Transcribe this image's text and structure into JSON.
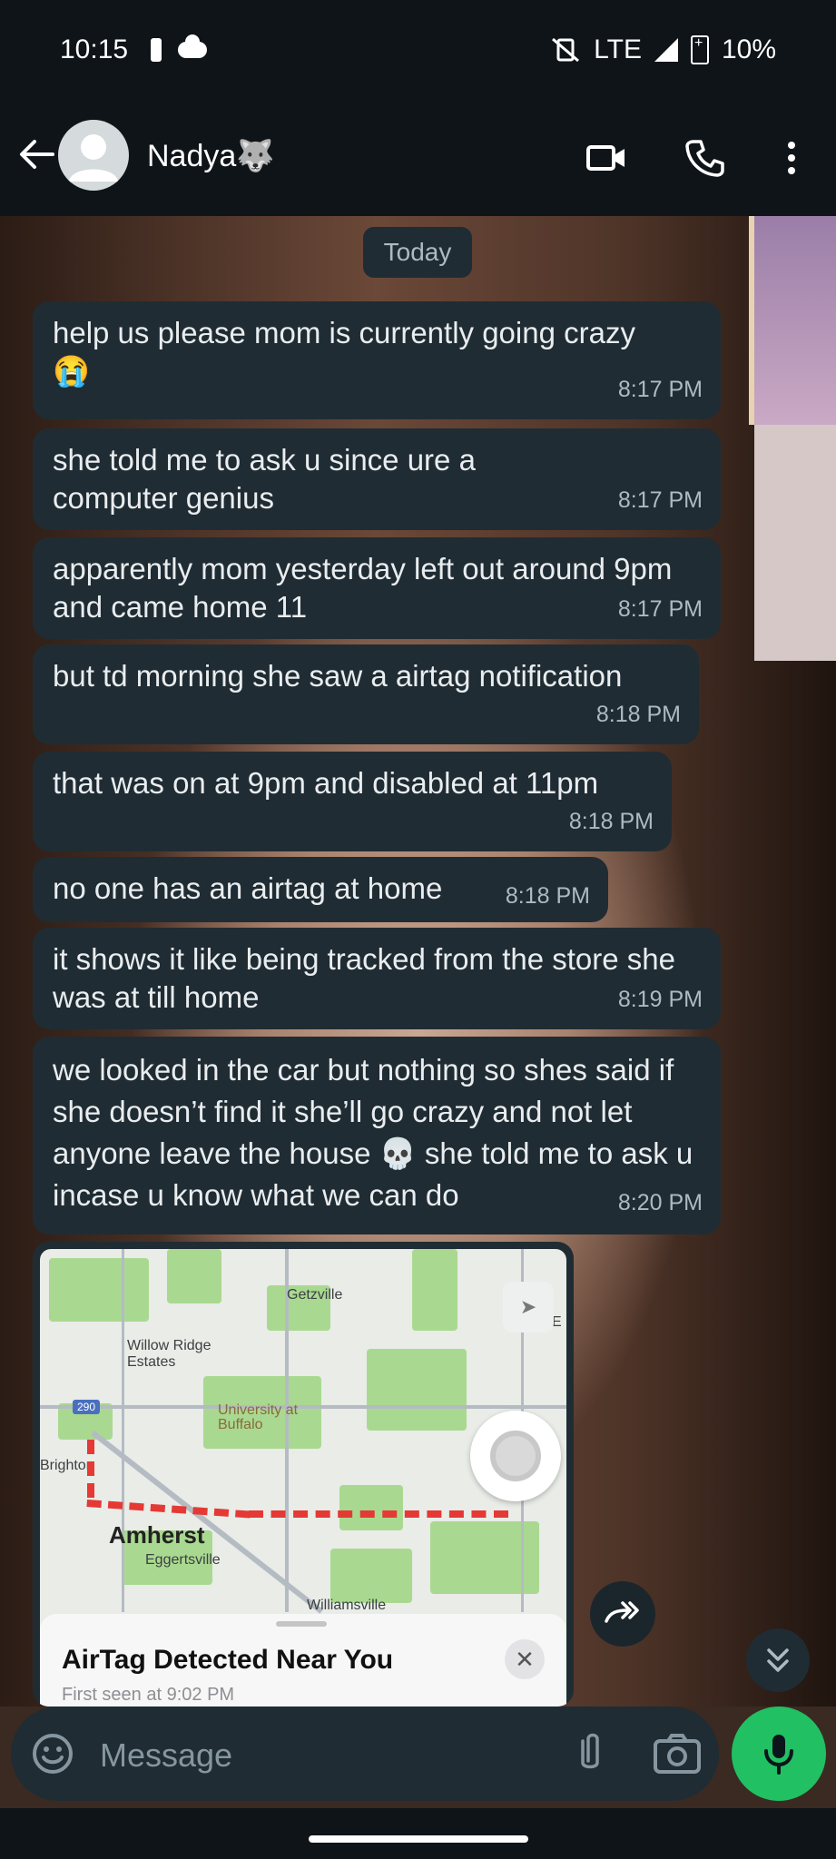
{
  "status_bar": {
    "time": "10:15",
    "network": "LTE",
    "battery": "10%"
  },
  "header": {
    "contact_name": "Nadya🐺"
  },
  "chat": {
    "date_chip": "Today",
    "messages": [
      {
        "text": "help us please mom is currently going crazy",
        "emoji": "😭",
        "time": "8:17 PM"
      },
      {
        "text": "she told me to ask u since ure a computer genius",
        "time": "8:17 PM"
      },
      {
        "text": "apparently mom yesterday left out around 9pm and came home 11",
        "time": "8:17 PM"
      },
      {
        "text": "but td morning she saw a airtag notification",
        "time": "8:18 PM"
      },
      {
        "text": "that was on at 9pm and disabled at 11pm",
        "time": "8:18 PM"
      },
      {
        "text": "no one has an airtag at home",
        "time": "8:18 PM"
      },
      {
        "text": "it shows it like being tracked from the store she was at till home",
        "time": "8:19 PM"
      },
      {
        "text_a": "we looked in the car but nothing so shes said if she doesn’t find it she’ll go crazy and not let anyone leave the house",
        "emoji": "💀",
        "text_b": "she told me to ask u incase u know what we can do",
        "time": "8:20 PM"
      }
    ],
    "map_card": {
      "labels": {
        "getzville": "Getzville",
        "willow_ridge": "Willow Ridge Estates",
        "university": "University at Buffalo",
        "brighton": "Brighton",
        "amherst": "Amherst",
        "eggertsville": "Eggertsville",
        "williamsville": "Williamsville",
        "highway": "290",
        "edge_e": "E"
      },
      "sheet_title": "AirTag Detected Near You",
      "sheet_subtitle": "First seen at 9:02 PM",
      "close_glyph": "✕"
    }
  },
  "composer": {
    "placeholder": "Message"
  },
  "colors": {
    "header_bg": "#0f1418",
    "bubble_bg": "#202c33",
    "accent_green": "#21c063",
    "route_red": "#e53935"
  }
}
